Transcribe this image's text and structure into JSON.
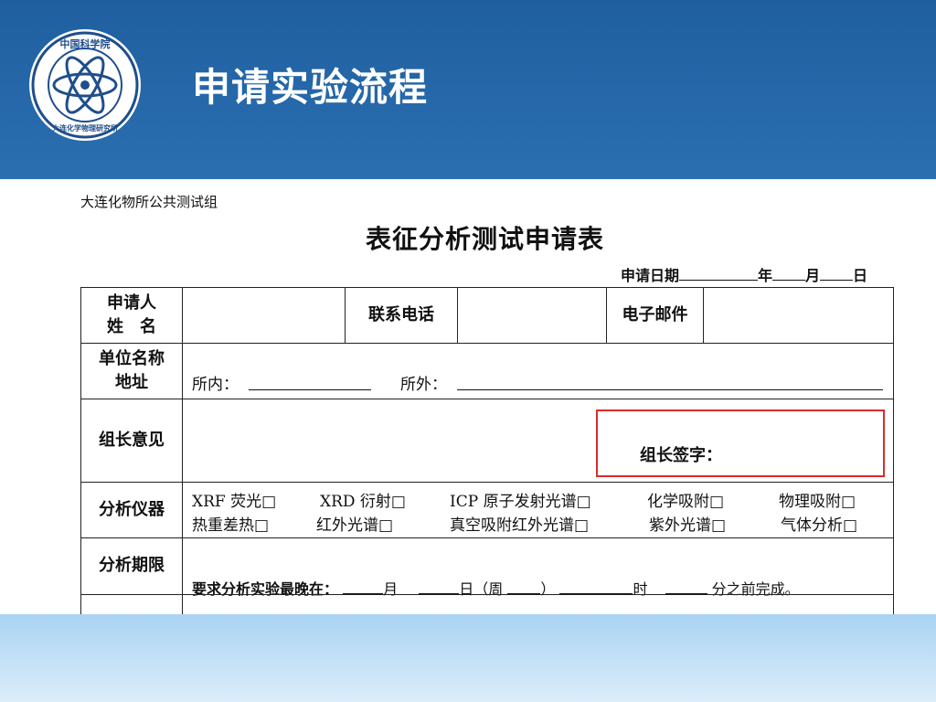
{
  "slide": {
    "title": "申请实验流程"
  },
  "logo": {
    "name": "cas-dicp-logo",
    "text_top": "中国科学院",
    "text_bottom": "大连化学物理研究所"
  },
  "form": {
    "org": "大连化物所公共测试组",
    "title": "表征分析测试申请表",
    "date_prefix": "申请日期",
    "date_year": "年",
    "date_month": "月",
    "date_day": "日",
    "rows": {
      "applicant_label": "申请人\n姓　名",
      "phone_label": "联系电话",
      "email_label": "电子邮件",
      "unit_label": "单位名称\n地址",
      "unit_inside": "所内：",
      "unit_outside": "所外：",
      "leader_label": "组长意见",
      "leader_sign": "组长签字：",
      "instrument_label": "分析仪器",
      "deadline_label": "分析期限"
    },
    "instruments": [
      [
        "XRF 荧光□",
        "XRD 衍射□",
        "ICP 原子发射光谱□",
        "化学吸附□",
        "物理吸附□"
      ],
      [
        "热重差热□",
        "红外光谱□",
        "真空吸附红外光谱□",
        "紫外光谱□",
        "气体分析□"
      ]
    ],
    "deadline": {
      "prefix": "要求分析实验最晚在：",
      "month": "月",
      "day": "日（周",
      "close": "）",
      "hour": "时",
      "minute_tail": "分之前完成。"
    }
  }
}
